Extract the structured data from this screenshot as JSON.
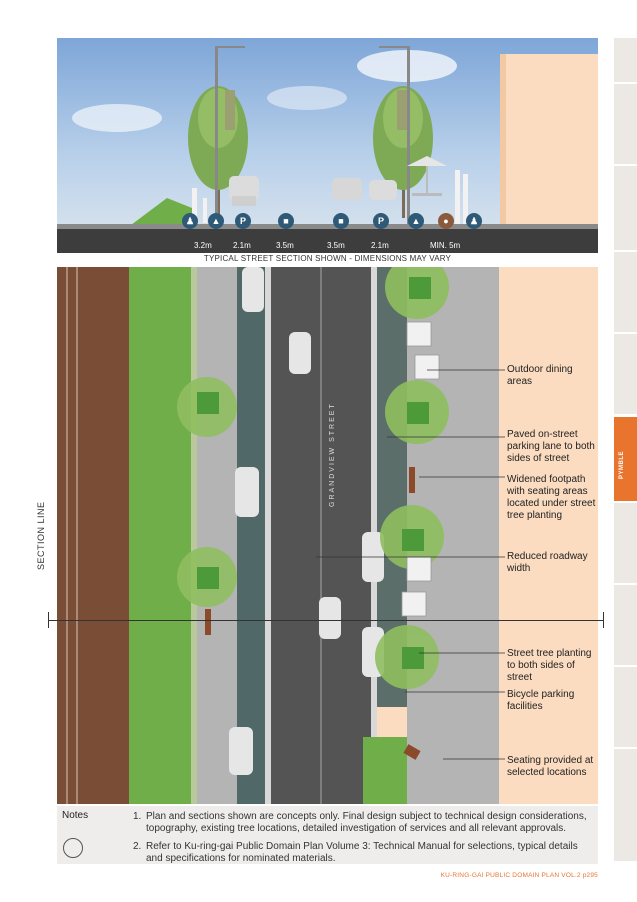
{
  "section": {
    "caption": "TYPICAL STREET SECTION SHOWN - DIMENSIONS MAY VARY",
    "dimensions": [
      "3.2m",
      "2.1m",
      "3.5m",
      "3.5m",
      "2.1m",
      "MIN. 5m"
    ],
    "icons": [
      "pedestrian-icon",
      "tree-icon",
      "parking-icon",
      "car-icon",
      "car-icon",
      "parking-icon",
      "tree-icon",
      "dining-icon",
      "pedestrian-icon"
    ],
    "parking_symbol": "P"
  },
  "plan": {
    "street_name": "GRANDVIEW STREET",
    "section_line_label": "SECTION LINE",
    "callouts": [
      "Outdoor dining areas",
      "Paved on-street parking lane to both sides of street",
      "Widened footpath with seating areas located under street tree planting",
      "Reduced roadway width",
      "Street tree planting to both sides of street",
      "Bicycle parking facilities",
      "Seating provided at selected locations"
    ]
  },
  "notes": {
    "title": "Notes",
    "items": [
      {
        "num": "1.",
        "text": "Plan and sections shown are concepts only. Final design subject to technical design considerations, topography, existing tree locations, detailed investigation of services and all relevant approvals."
      },
      {
        "num": "2.",
        "text": "Refer to Ku-ring-gai Public Domain Plan Volume 3: Technical Manual for selections, typical details and specifications for nominated materials."
      }
    ]
  },
  "side_tab": {
    "label": "PYMBLE"
  },
  "footer": {
    "text": "KU-RING-GAI PUBLIC DOMAIN PLAN     VOL.2 p295"
  },
  "colors": {
    "accent": "#e8742e",
    "road": "#545454",
    "footpath": "#b4b4b4",
    "grass": "#6fae48",
    "icon": "#2e5a78",
    "building": "#fbdcc0"
  }
}
